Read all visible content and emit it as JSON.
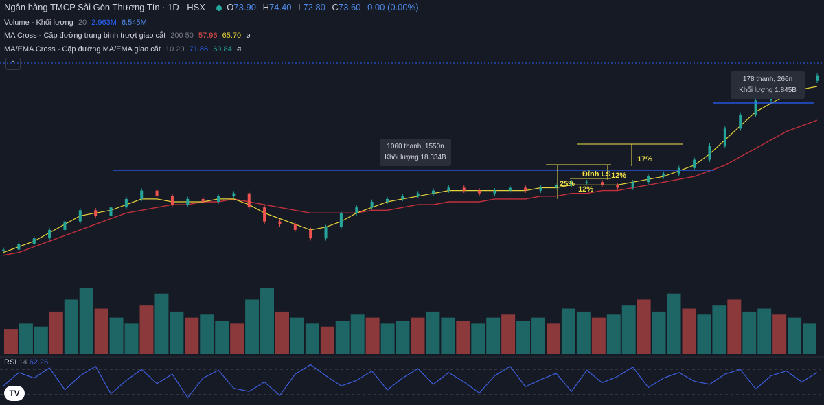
{
  "header": {
    "symbol_title": "Ngân hàng TMCP Sài Gòn Thương Tín · 1D · HSX",
    "ohlc": [
      {
        "k": "O",
        "v": "73.90"
      },
      {
        "k": "H",
        "v": "74.40"
      },
      {
        "k": "L",
        "v": "72.80"
      },
      {
        "k": "C",
        "v": "73.60"
      }
    ],
    "change": "0.00 (0.00%)"
  },
  "indicators": {
    "volume": {
      "label": "Volume - Khối lượng",
      "param": "20",
      "v1": "2.963M",
      "v2": "6.545M"
    },
    "ma_cross": {
      "label": "MA Cross - Cặp đường trung bình trượt giao cắt",
      "params": "200 50",
      "v1": "57.96",
      "v2": "65.70",
      "tail": "ø"
    },
    "ma_ema_cross": {
      "label": "MA/EMA Cross - Cặp đường MA/EMA giao cắt",
      "params": "10 20",
      "v1": "71.86",
      "v2": "69.84",
      "tail": "ø"
    },
    "rsi": {
      "label": "RSI",
      "param": "14",
      "value": "62.26"
    }
  },
  "colors": {
    "bg": "#161a25",
    "up": "#26a69a",
    "down": "#ef5350",
    "ma_slow": "#c2303c",
    "ma_fast": "#e6d23a",
    "rsi": "#3f5fe0",
    "hline": "#2962ff",
    "annotation": "#f0e14a",
    "grid_dash": "#50535e"
  },
  "annotations": {
    "tooltip_long": {
      "line1": "1060 thanh, 1550n",
      "line2": "Khối lượng 18.334B"
    },
    "tooltip_short": {
      "line1": "178 thanh, 266n",
      "line2": "Khối lượng 1.845B"
    },
    "pct_25": "25%",
    "pct_12a": "12%",
    "pct_12b": "12%",
    "pct_17": "17%",
    "dinh_ls": "Đỉnh LS"
  },
  "icons": {
    "collapse": "chevron-up-icon",
    "logo": "tradingview-logo"
  },
  "logo_text": "TV",
  "chart_data": {
    "type": "line",
    "title": "Ngân hàng TMCP Sài Gòn Thương Tín · 1D · HSX",
    "x_unit": "bar index (daily)",
    "series": [
      {
        "name": "Price",
        "values": [
          12,
          14,
          16,
          19,
          22,
          26,
          24,
          27,
          30,
          33,
          31,
          28,
          30,
          29,
          31,
          32,
          27,
          22,
          21,
          19,
          16,
          20,
          25,
          27,
          29,
          30,
          31,
          32,
          33,
          34,
          33,
          32,
          33,
          34,
          33,
          34,
          35,
          36,
          36,
          35,
          34,
          36,
          38,
          39,
          41,
          44,
          49,
          55,
          60,
          65,
          68,
          71,
          72,
          74
        ]
      },
      {
        "name": "MA 200",
        "values": [
          10,
          11,
          13,
          15,
          17,
          19,
          21,
          23,
          25,
          26,
          27,
          28,
          28,
          29,
          29,
          30,
          29,
          28,
          27,
          26,
          25,
          25,
          25,
          25,
          26,
          26,
          27,
          28,
          28,
          29,
          29,
          29,
          30,
          30,
          30,
          31,
          31,
          32,
          32,
          33,
          33,
          34,
          35,
          36,
          37,
          38,
          40,
          42,
          45,
          48,
          51,
          54,
          56,
          58
        ]
      },
      {
        "name": "MA 50",
        "values": [
          11,
          13,
          15,
          18,
          21,
          24,
          25,
          26,
          28,
          30,
          30,
          29,
          29,
          29,
          30,
          30,
          28,
          25,
          23,
          21,
          19,
          20,
          22,
          25,
          27,
          29,
          30,
          31,
          32,
          33,
          33,
          33,
          33,
          33,
          33,
          34,
          34,
          35,
          35,
          35,
          35,
          36,
          37,
          38,
          40,
          42,
          46,
          51,
          56,
          61,
          64,
          67,
          69,
          70
        ]
      }
    ],
    "rsi": [
      45,
      62,
      55,
      68,
      40,
      58,
      70,
      35,
      52,
      66,
      48,
      60,
      30,
      55,
      65,
      42,
      38,
      50,
      33,
      60,
      72,
      58,
      45,
      52,
      64,
      40,
      55,
      67,
      47,
      62,
      50,
      36,
      58,
      70,
      44,
      53,
      61,
      38,
      65,
      49,
      57,
      69,
      43,
      55,
      62,
      51,
      47,
      60,
      66,
      41,
      58,
      64,
      50,
      62
    ],
    "volume": [
      8,
      10,
      9,
      14,
      18,
      22,
      15,
      12,
      10,
      16,
      20,
      14,
      12,
      13,
      11,
      10,
      18,
      22,
      14,
      12,
      10,
      9,
      11,
      13,
      12,
      10,
      11,
      12,
      14,
      12,
      11,
      10,
      12,
      13,
      11,
      12,
      10,
      15,
      14,
      12,
      13,
      16,
      18,
      14,
      20,
      15,
      13,
      16,
      18,
      14,
      15,
      13,
      12,
      10
    ],
    "ylim": [
      8,
      80
    ],
    "grid": false,
    "legend": "top-left"
  }
}
